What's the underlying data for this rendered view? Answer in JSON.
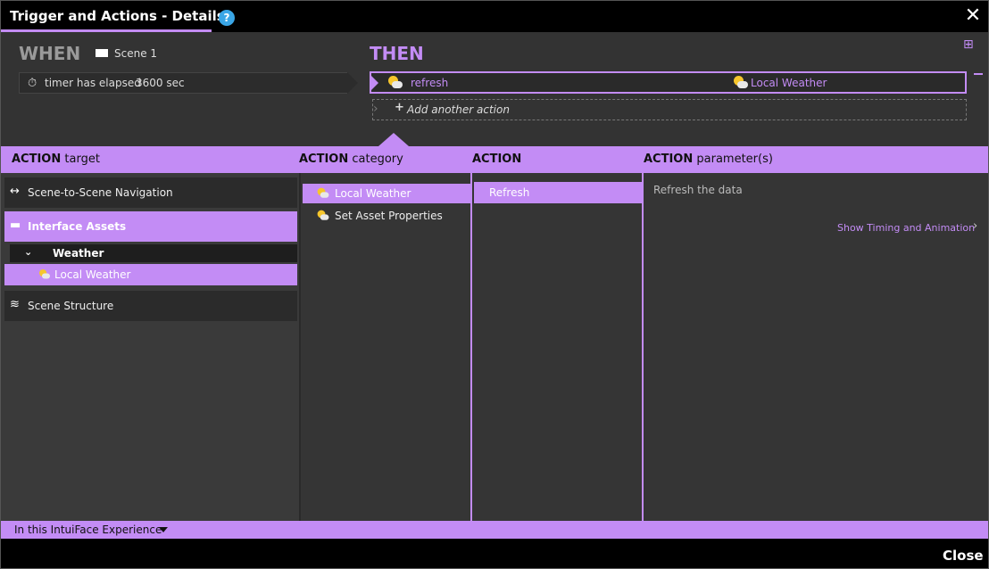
{
  "window": {
    "title": "Trigger and Actions - Details",
    "help_label": "?",
    "close_symbol": "✕"
  },
  "when": {
    "label": "WHEN",
    "scene": "Scene 1",
    "trigger_text": "timer has elapsed",
    "trigger_value": "3600 sec"
  },
  "then": {
    "label": "THEN",
    "action_name": "refresh",
    "action_target": "Local Weather",
    "add_action": "Add another action"
  },
  "headers": {
    "target_bold": "ACTION",
    "target_rest": "target",
    "category_bold": "ACTION",
    "category_rest": "category",
    "action_bold": "ACTION",
    "params_bold": "ACTION",
    "params_rest": "parameter(s)"
  },
  "targets": {
    "nav": "Scene-to-Scene Navigation",
    "interface_assets": "Interface Assets",
    "weather_group": "Weather",
    "local_weather": "Local Weather",
    "scene_structure": "Scene Structure"
  },
  "categories": {
    "local_weather": "Local Weather",
    "set_asset_properties": "Set Asset Properties"
  },
  "actions": {
    "refresh": "Refresh"
  },
  "parameters": {
    "description": "Refresh the data",
    "timing_link": "Show Timing and Animation"
  },
  "footer": {
    "scope": "In this IntuiFace Experience",
    "close": "Close"
  },
  "colors": {
    "accent": "#c38cf5",
    "help": "#3aa6e6"
  },
  "icons": [
    "timer-icon",
    "weather-icon",
    "grid-icon",
    "navigation-arrows-icon",
    "assets-icon",
    "layers-icon",
    "chevron-down-icon",
    "chevron-right-icon",
    "plus-icon",
    "close-icon",
    "help-icon"
  ]
}
